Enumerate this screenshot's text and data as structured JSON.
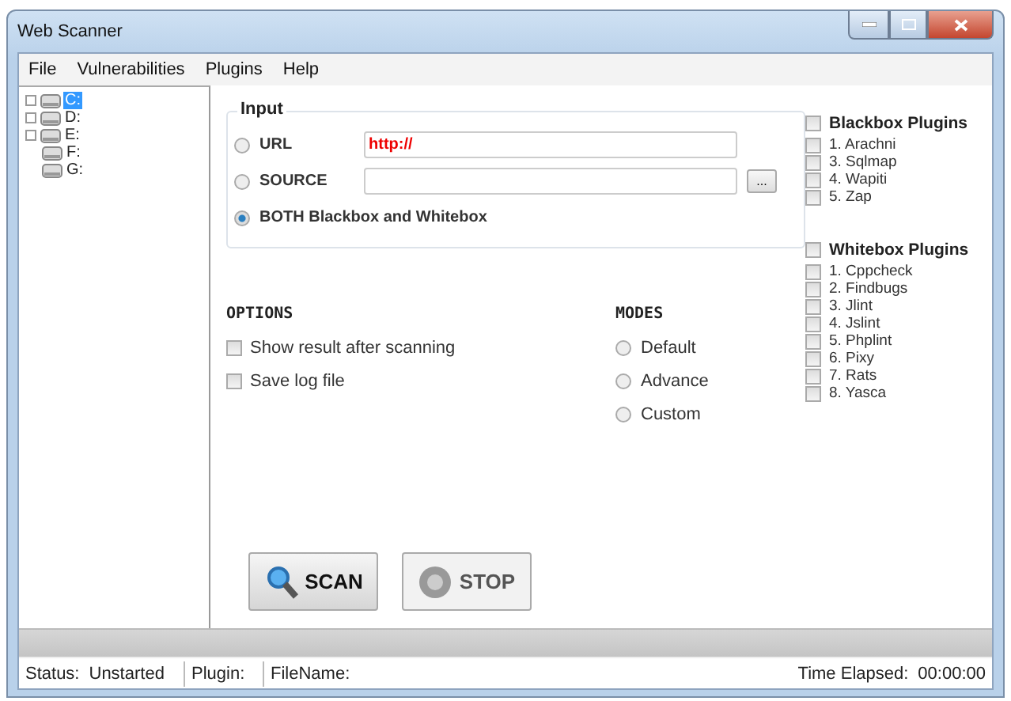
{
  "window": {
    "title": "Web Scanner"
  },
  "menu": [
    "File",
    "Vulnerabilities",
    "Plugins",
    "Help"
  ],
  "drives": [
    {
      "label": "C:",
      "expandable": true,
      "selected": true
    },
    {
      "label": "D:",
      "expandable": true,
      "selected": false
    },
    {
      "label": "E:",
      "expandable": true,
      "selected": false
    },
    {
      "label": "F:",
      "expandable": false,
      "selected": false
    },
    {
      "label": "G:",
      "expandable": false,
      "selected": false
    }
  ],
  "input": {
    "title": "Input",
    "sources": [
      {
        "kind": "field",
        "label": "URL",
        "selected": false,
        "value": "http://"
      },
      {
        "kind": "field",
        "label": "SOURCE",
        "selected": false,
        "browse": "..."
      },
      {
        "kind": "plain",
        "label": "BOTH Blackbox and Whitebox",
        "selected": true
      }
    ]
  },
  "options": {
    "title": "OPTIONS",
    "items": [
      {
        "label": "Show result after scanning",
        "checked": false
      },
      {
        "label": "Save log file",
        "checked": false
      }
    ]
  },
  "modes": {
    "title": "MODES",
    "items": [
      {
        "label": "Default",
        "selected": false
      },
      {
        "label": "Advance",
        "selected": false
      },
      {
        "label": "Custom",
        "selected": false
      }
    ]
  },
  "plugin_groups": [
    {
      "title": "Blackbox Plugins",
      "checked": false,
      "items": [
        {
          "label": "1. Arachni",
          "checked": false
        },
        {
          "label": "3. Sqlmap",
          "checked": false
        },
        {
          "label": "4. Wapiti",
          "checked": false
        },
        {
          "label": "5. Zap",
          "checked": false
        }
      ]
    },
    {
      "title": "Whitebox Plugins",
      "checked": false,
      "items": [
        {
          "label": "1. Cppcheck",
          "checked": false
        },
        {
          "label": "2. Findbugs",
          "checked": false
        },
        {
          "label": "3. Jlint",
          "checked": false
        },
        {
          "label": "4. Jslint",
          "checked": false
        },
        {
          "label": "5. Phplint",
          "checked": false
        },
        {
          "label": "6. Pixy",
          "checked": false
        },
        {
          "label": "7. Rats",
          "checked": false
        },
        {
          "label": "8. Yasca",
          "checked": false
        }
      ]
    }
  ],
  "buttons": [
    {
      "kind": "scan",
      "label": "SCAN",
      "disabled": false
    },
    {
      "kind": "stop",
      "label": "STOP",
      "disabled": true
    }
  ],
  "progress": {
    "level": 0
  },
  "status_bar": {
    "status_label": "Status:",
    "status": "Unstarted",
    "plugin_label": "Plugin:",
    "file_label": "FileName:",
    "time_label": "Time Elapsed:",
    "time": "00:00:00"
  }
}
